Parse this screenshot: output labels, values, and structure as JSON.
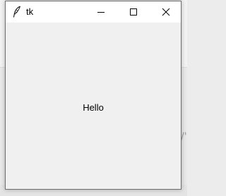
{
  "window": {
    "title": "tk",
    "app_icon": "feather-icon",
    "controls": {
      "minimize_icon": "minimize-icon",
      "maximize_icon": "maximize-icon",
      "close_icon": "close-icon"
    }
  },
  "content": {
    "label_text": "Hello"
  },
  "colors": {
    "titlebar": "#ffffff",
    "client_area": "#f0f0f0",
    "border": "#6f6f6f",
    "text": "#000000"
  }
}
